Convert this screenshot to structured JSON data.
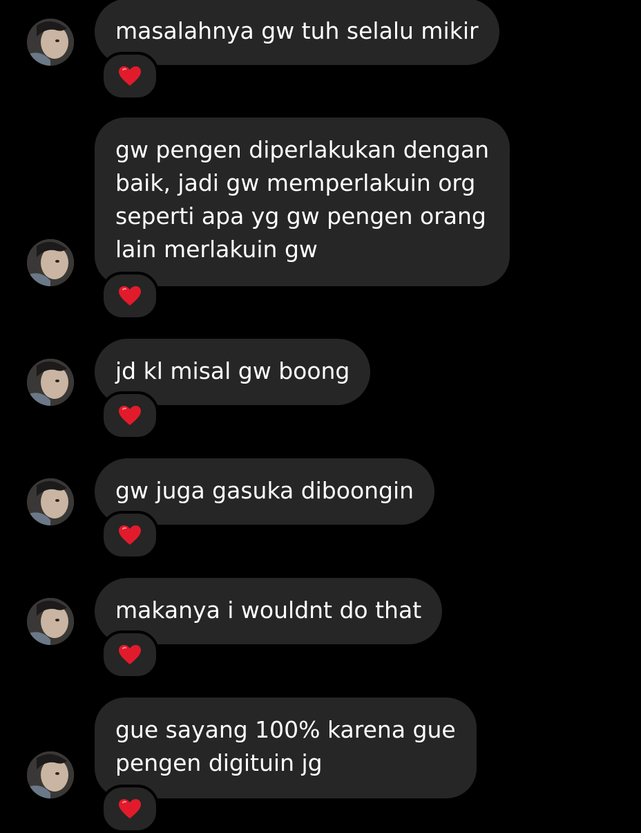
{
  "messages": [
    {
      "text": "masalahnya gw tuh selalu mikir",
      "reaction": "red-heart-icon",
      "reaction_color": "#e21b2c"
    },
    {
      "text": "gw pengen diperlakukan dengan\nbaik, jadi gw memperlakuin org\nseperti apa yg gw pengen orang\nlain merlakuin gw",
      "reaction": "red-heart-icon",
      "reaction_color": "#e21b2c"
    },
    {
      "text": "jd kl misal gw boong",
      "reaction": "red-heart-icon",
      "reaction_color": "#e21b2c"
    },
    {
      "text": "gw juga gasuka diboongin",
      "reaction": "red-heart-icon",
      "reaction_color": "#e21b2c"
    },
    {
      "text": "makanya i wouldnt do that",
      "reaction": "red-heart-icon",
      "reaction_color": "#e21b2c"
    },
    {
      "text": "gue sayang 100% karena gue\npengen digituin jg",
      "reaction": "red-heart-icon",
      "reaction_color": "#e21b2c"
    }
  ],
  "colors": {
    "background": "#000000",
    "bubble": "#262626",
    "text": "#ffffff"
  }
}
